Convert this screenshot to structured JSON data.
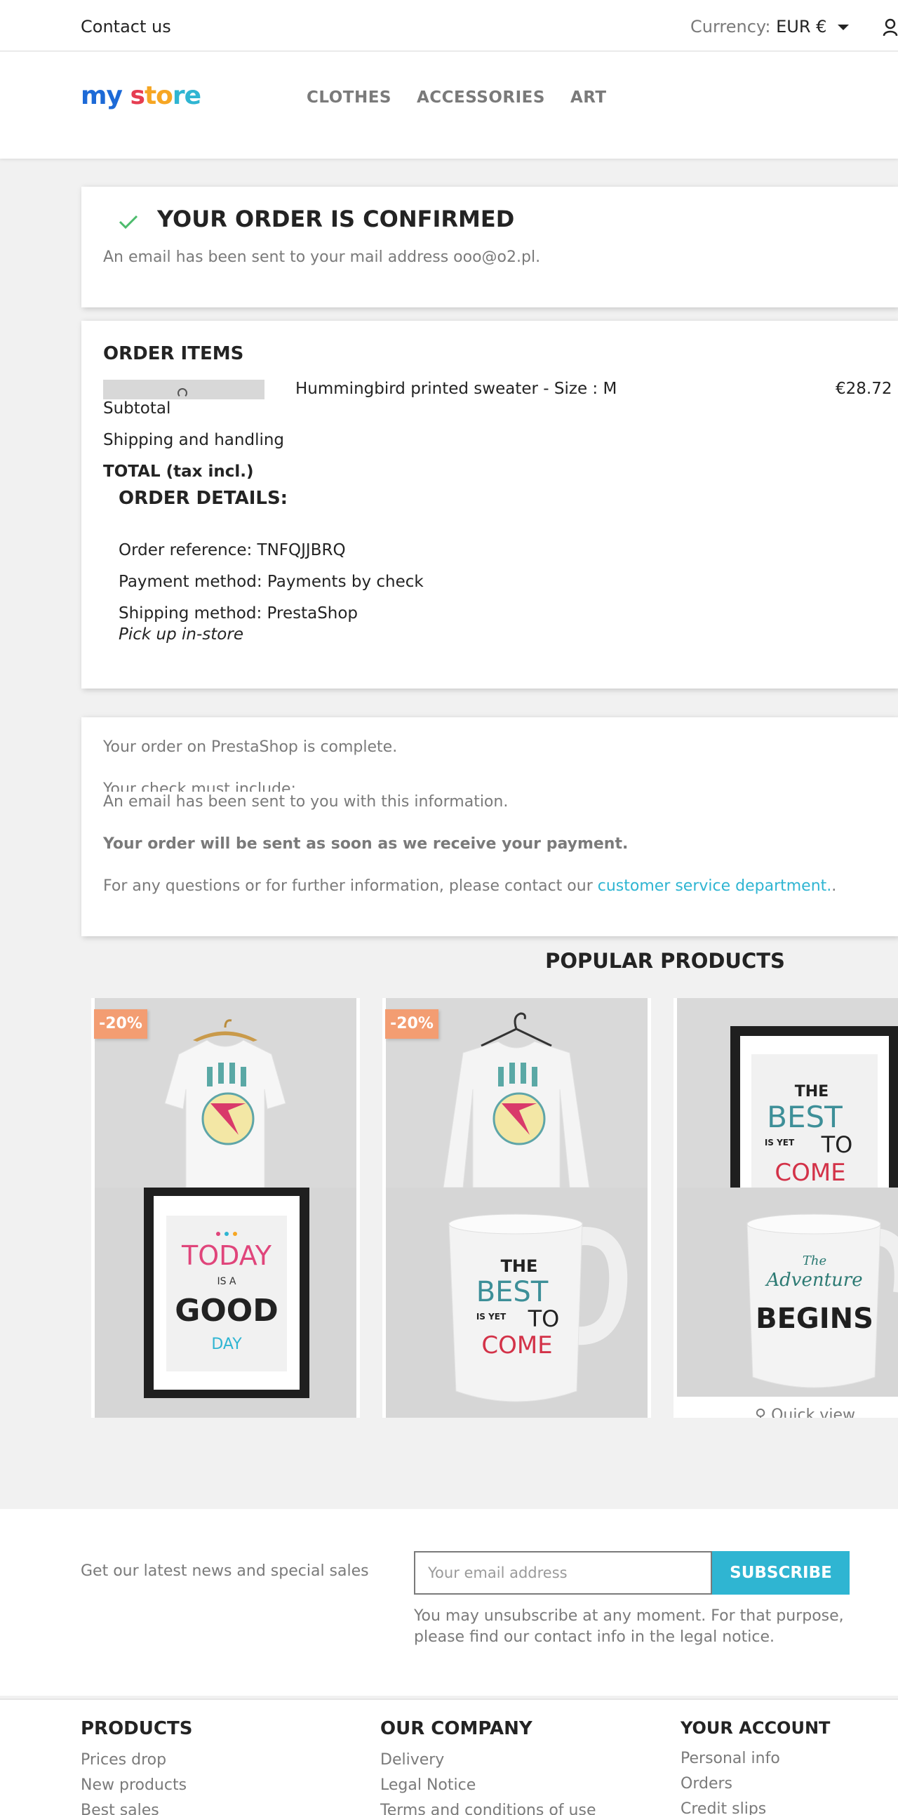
{
  "topbar": {
    "contact": "Contact us",
    "currency_label": "Currency:",
    "currency_value": "EUR €"
  },
  "header": {
    "logo": {
      "p1": "my",
      "p2": " s",
      "p3": "to",
      "p4": "re"
    },
    "nav": [
      "CLOTHES",
      "ACCESSORIES",
      "ART"
    ]
  },
  "confirmation": {
    "title": "YOUR ORDER IS CONFIRMED",
    "message": "An email has been sent to your mail address ooo@o2.pl."
  },
  "order_items": {
    "heading": "ORDER ITEMS",
    "item_name": "Hummingbird printed sweater - Size : M",
    "item_price": "€28.72",
    "subtotal": "Subtotal",
    "shipping": "Shipping and handling",
    "total": "TOTAL (tax incl.)"
  },
  "order_details": {
    "heading": "ORDER DETAILS:",
    "reference": "Order reference: TNFQJJBRQ",
    "payment": "Payment method: Payments by check",
    "shipping_method": "Shipping method: PrestaShop",
    "shipping_note": "Pick up in-store"
  },
  "payment_info": {
    "complete": "Your order on PrestaShop is complete.",
    "check_include": "Your check must include:",
    "email_sent": "An email has been sent to you with this information.",
    "will_send": "Your order will be sent as soon as we receive your payment.",
    "questions": "For any questions or for further information, please contact our ",
    "link": "customer service department.",
    "tail": "."
  },
  "popular": {
    "title": "POPULAR PRODUCTS",
    "badge1": "-20%",
    "badge2": "-20%",
    "quick_view": "Quick view",
    "art": {
      "today": "TODAY",
      "is_a": "IS A",
      "good": "GOOD",
      "day": "DAY",
      "the": "THE",
      "best": "BEST",
      "is_yet": "IS YET",
      "to": "TO",
      "come": "COME",
      "the_small": "The",
      "adventure": "Adventure",
      "begins": "BEGINS"
    }
  },
  "newsletter": {
    "text": "Get our latest news and special sales",
    "placeholder": "Your email address",
    "button": "SUBSCRIBE",
    "note": "You may unsubscribe at any moment. For that purpose, please find our contact info in the legal notice."
  },
  "footer": {
    "products_title": "PRODUCTS",
    "products": [
      "Prices drop",
      "New products",
      "Best sales"
    ],
    "company_title": "OUR COMPANY",
    "company": [
      "Delivery",
      "Legal Notice",
      "Terms and conditions of use"
    ],
    "account_title": "YOUR ACCOUNT",
    "account": [
      "Personal info",
      "Orders",
      "Credit slips"
    ]
  },
  "colors": {
    "accent": "#2fb5d2",
    "badge": "#f39d72",
    "check": "#4cbb6c"
  }
}
